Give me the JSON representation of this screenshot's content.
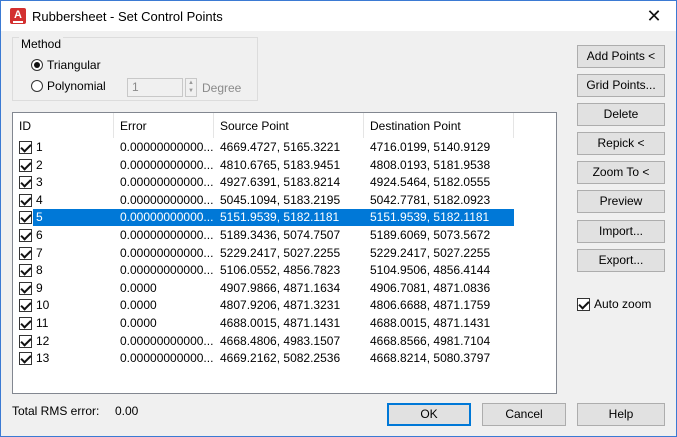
{
  "window": {
    "title": "Rubbersheet - Set Control Points",
    "app_icon_letter": "A",
    "close_glyph": "✕"
  },
  "method": {
    "legend": "Method",
    "options": [
      {
        "label": "Triangular",
        "checked": true
      },
      {
        "label": "Polynomial",
        "checked": false
      }
    ],
    "degree_value": "1",
    "degree_label": "Degree"
  },
  "table": {
    "columns": [
      "ID",
      "Error",
      "Source Point",
      "Destination Point"
    ],
    "selected_index": 4,
    "rows": [
      {
        "checked": true,
        "id": "1",
        "error": "0.00000000000...",
        "source": "4669.4727, 5165.3221",
        "destination": "4716.0199, 5140.9129"
      },
      {
        "checked": true,
        "id": "2",
        "error": "0.00000000000...",
        "source": "4810.6765, 5183.9451",
        "destination": "4808.0193, 5181.9538"
      },
      {
        "checked": true,
        "id": "3",
        "error": "0.00000000000...",
        "source": "4927.6391, 5183.8214",
        "destination": "4924.5464, 5182.0555"
      },
      {
        "checked": true,
        "id": "4",
        "error": "0.00000000000...",
        "source": "5045.1094, 5183.2195",
        "destination": "5042.7781, 5182.0923"
      },
      {
        "checked": true,
        "id": "5",
        "error": "0.00000000000...",
        "source": "5151.9539, 5182.1181",
        "destination": "5151.9539, 5182.1181"
      },
      {
        "checked": true,
        "id": "6",
        "error": "0.00000000000...",
        "source": "5189.3436, 5074.7507",
        "destination": "5189.6069, 5073.5672"
      },
      {
        "checked": true,
        "id": "7",
        "error": "0.00000000000...",
        "source": "5229.2417, 5027.2255",
        "destination": "5229.2417, 5027.2255"
      },
      {
        "checked": true,
        "id": "8",
        "error": "0.00000000000...",
        "source": "5106.0552, 4856.7823",
        "destination": "5104.9506, 4856.4144"
      },
      {
        "checked": true,
        "id": "9",
        "error": "0.0000",
        "source": "4907.9866, 4871.1634",
        "destination": "4906.7081, 4871.0836"
      },
      {
        "checked": true,
        "id": "10",
        "error": "0.0000",
        "source": "4807.9206, 4871.3231",
        "destination": "4806.6688, 4871.1759"
      },
      {
        "checked": true,
        "id": "11",
        "error": "0.0000",
        "source": "4688.0015, 4871.1431",
        "destination": "4688.0015, 4871.1431"
      },
      {
        "checked": true,
        "id": "12",
        "error": "0.00000000000...",
        "source": "4668.4806, 4983.1507",
        "destination": "4668.8566, 4981.7104"
      },
      {
        "checked": true,
        "id": "13",
        "error": "0.00000000000...",
        "source": "4669.2162, 5082.2536",
        "destination": "4668.8214, 5080.3797"
      }
    ]
  },
  "side_buttons": {
    "add_points": "Add Points <",
    "grid_points": "Grid Points...",
    "delete": "Delete",
    "repick": "Repick <",
    "zoom_to": "Zoom To <",
    "preview": "Preview",
    "import": "Import...",
    "export": "Export..."
  },
  "auto_zoom": {
    "label": "Auto zoom",
    "checked": true
  },
  "footer": {
    "rms_label": "Total RMS error:",
    "rms_value": "0.00",
    "ok": "OK",
    "cancel": "Cancel",
    "help": "Help"
  },
  "colors": {
    "selection": "#0078d7",
    "app_icon": "#d32f2f",
    "window_border": "#3b7ad3"
  }
}
